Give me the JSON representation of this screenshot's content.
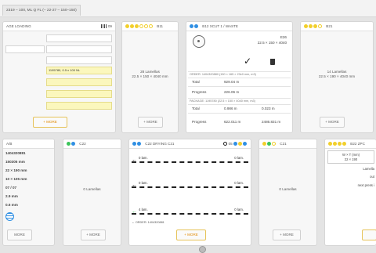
{
  "topbar": {
    "tab": "2319 – 100, ML Q FL (– 22-27 – 150–150)"
  },
  "colors": {
    "yellow": "#f2cf2a",
    "green": "#3bc45a",
    "blue": "#2f8fe3",
    "accent": "#e08a00"
  },
  "p1": {
    "title": "AGE LOADING",
    "icon": "barcode-icon",
    "sub": "09",
    "highlight": "1195780, 0.5 x 100 NL",
    "more": "+ MORE"
  },
  "p2": {
    "title": "B11",
    "count": "28 Lamellas",
    "dim": "22.5 × 150 × 4040 mm",
    "more": "+ MORE"
  },
  "p3": {
    "title": "B12 XCUT 1 / WASTE",
    "top_right_1": "E26",
    "top_right_2": "22.5 × 150 × 4040",
    "order_label": "ORDER: 1404320880 (150 × 165 × 23x0 mm, m3)",
    "total_label": "Total",
    "total_val": "929.04 m",
    "progress_label": "Progress",
    "progress_val": "226.06 m",
    "package_label": "PACKAGE: 1195780 (22.5 × 150 × 4040 mm, m3)",
    "pkg_total_val1": "0.986 m",
    "pkg_total_val2": "0.023 m",
    "pkg_progress_val1": "622.011 m",
    "pkg_progress_val2": "2486.831 m"
  },
  "p4": {
    "title": "B21",
    "count": "14 Lamellas",
    "dim": "22.5 × 190 × 4040 mm",
    "more": "+ MORE"
  },
  "p5": {
    "title": "A/B",
    "lines": [
      "1404320881",
      "150305 mm",
      "22 × 190 mm",
      "10 × 105 mm",
      "07 / 07",
      "2.9 mm",
      "0.6 mm"
    ],
    "more": "MORE"
  },
  "p6": {
    "title": "C22",
    "count": "0 Lamellas",
    "more": "+ MORE"
  },
  "p7": {
    "title": "C22 DRYING C21",
    "count_small": "05",
    "rows": [
      {
        "l": "0 lam.",
        "r": "0 lam."
      },
      {
        "l": "0 lam.",
        "r": "0 lam."
      },
      {
        "l": "4 lam.",
        "r": "0 lam."
      }
    ],
    "order": "← ORDER: 1404320881",
    "more": "+ MORE"
  },
  "p8": {
    "title": "C21",
    "count": "0 Lamellas",
    "more": "+ MORE"
  },
  "p9": {
    "title": "B22 ZPC",
    "h1": "W × T (mm)",
    "h2": "22 × 190",
    "l1": "Lamella",
    "l2": "out",
    "l3": "next press i"
  }
}
